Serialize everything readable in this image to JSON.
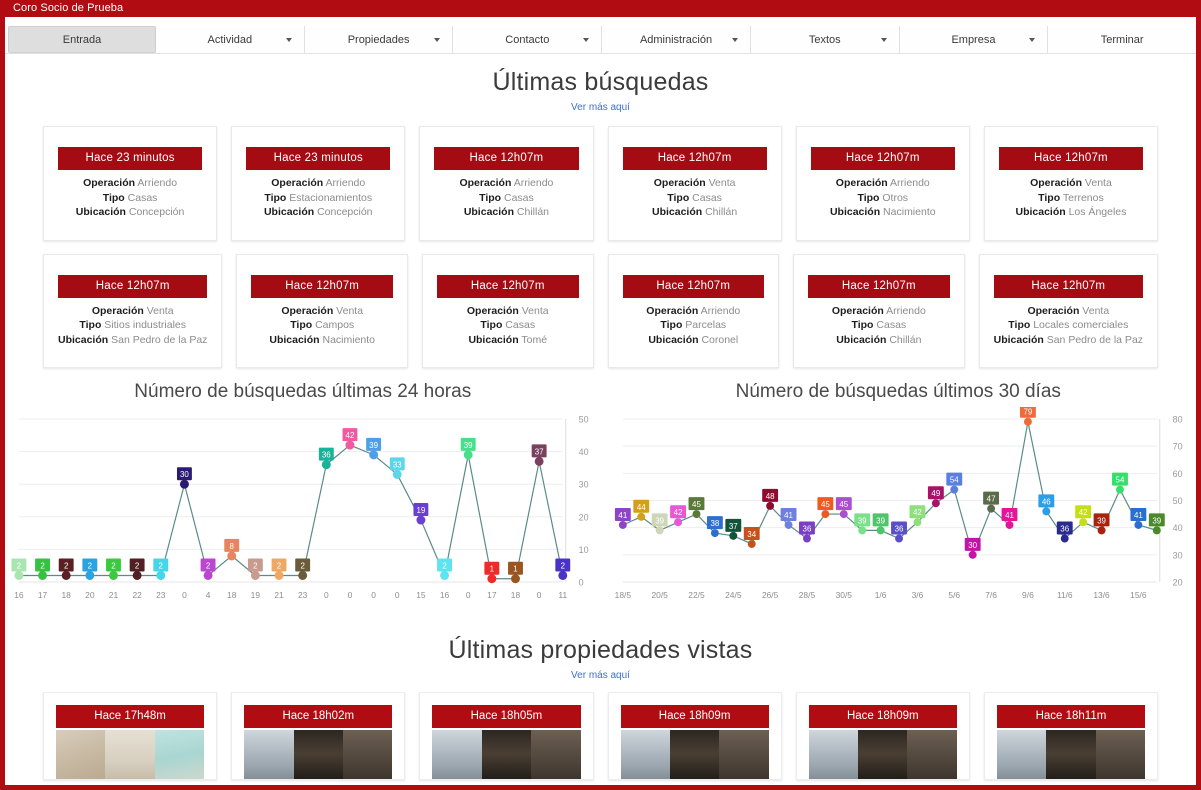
{
  "window": {
    "title": "Coro Socio de Prueba"
  },
  "nav": {
    "items": [
      {
        "label": "Entrada",
        "caret": false
      },
      {
        "label": "Actividad",
        "caret": true
      },
      {
        "label": "Propiedades",
        "caret": true
      },
      {
        "label": "Contacto",
        "caret": true
      },
      {
        "label": "Administración",
        "caret": true
      },
      {
        "label": "Textos",
        "caret": true
      },
      {
        "label": "Empresa",
        "caret": true
      },
      {
        "label": "Terminar",
        "caret": false
      }
    ]
  },
  "searches": {
    "title": "Últimas búsquedas",
    "link": "Ver más aquí",
    "labels": {
      "operacion": "Operación",
      "tipo": "Tipo",
      "ubicacion": "Ubicación"
    },
    "cards": [
      {
        "time": "Hace 23 minutos",
        "operacion": "Arriendo",
        "tipo": "Casas",
        "ubicacion": "Concepción"
      },
      {
        "time": "Hace 23 minutos",
        "operacion": "Arriendo",
        "tipo": "Estacionamientos",
        "ubicacion": "Concepción"
      },
      {
        "time": "Hace 12h07m",
        "operacion": "Arriendo",
        "tipo": "Casas",
        "ubicacion": "Chillán"
      },
      {
        "time": "Hace 12h07m",
        "operacion": "Venta",
        "tipo": "Casas",
        "ubicacion": "Chillán"
      },
      {
        "time": "Hace 12h07m",
        "operacion": "Arriendo",
        "tipo": "Otros",
        "ubicacion": "Nacimiento"
      },
      {
        "time": "Hace 12h07m",
        "operacion": "Venta",
        "tipo": "Terrenos",
        "ubicacion": "Los Ángeles"
      },
      {
        "time": "Hace 12h07m",
        "operacion": "Venta",
        "tipo": "Sitios industriales",
        "ubicacion": "San Pedro de la Paz"
      },
      {
        "time": "Hace 12h07m",
        "operacion": "Venta",
        "tipo": "Campos",
        "ubicacion": "Nacimiento"
      },
      {
        "time": "Hace 12h07m",
        "operacion": "Venta",
        "tipo": "Casas",
        "ubicacion": "Tomé"
      },
      {
        "time": "Hace 12h07m",
        "operacion": "Arriendo",
        "tipo": "Parcelas",
        "ubicacion": "Coronel"
      },
      {
        "time": "Hace 12h07m",
        "operacion": "Arriendo",
        "tipo": "Casas",
        "ubicacion": "Chillán"
      },
      {
        "time": "Hace 12h07m",
        "operacion": "Venta",
        "tipo": "Locales comerciales",
        "ubicacion": "San Pedro de la Paz"
      }
    ]
  },
  "properties": {
    "title": "Últimas propiedades vistas",
    "link": "Ver más aquí",
    "cards": [
      {
        "time": "Hace 17h48m",
        "photo": "art"
      },
      {
        "time": "Hace 18h02m",
        "photo": "sky"
      },
      {
        "time": "Hace 18h05m",
        "photo": "sky"
      },
      {
        "time": "Hace 18h09m",
        "photo": "sky"
      },
      {
        "time": "Hace 18h09m",
        "photo": "sky"
      },
      {
        "time": "Hace 18h11m",
        "photo": "sky"
      }
    ]
  },
  "chart_data": [
    {
      "type": "line",
      "title": "Número de búsquedas últimas 24 horas",
      "xlabel": "",
      "ylabel": "",
      "ylim": [
        0,
        50
      ],
      "yticks": [
        0,
        10,
        20,
        30,
        40,
        50
      ],
      "grid": true,
      "legend": false,
      "axis_position": "right",
      "categories": [
        "16",
        "17",
        "18",
        "20",
        "21",
        "22",
        "23",
        "0",
        "4",
        "18",
        "19",
        "21",
        "23",
        "0",
        "0",
        "0",
        "0",
        "15",
        "16",
        "0",
        "17",
        "18",
        "0",
        "11"
      ],
      "values": [
        2,
        2,
        2,
        2,
        2,
        2,
        2,
        30,
        2,
        8,
        2,
        2,
        2,
        36,
        42,
        39,
        33,
        19,
        2,
        39,
        1,
        1,
        37,
        2
      ],
      "point_colors": [
        "#a9e5b0",
        "#35c23f",
        "#5c1f22",
        "#2aa3e0",
        "#3bc93f",
        "#521f22",
        "#45d6e8",
        "#2b1b72",
        "#bb46d0",
        "#e8845e",
        "#c99a8e",
        "#efa863",
        "#6b5b3a",
        "#19b39a",
        "#ef5aa0",
        "#4f9fe8",
        "#5cd6e8",
        "#6c3fd4",
        "#5ce4f0",
        "#46e08a",
        "#ef2a2a",
        "#9a5520",
        "#7a4060",
        "#4a34c8"
      ],
      "label_colors": [
        "#a9e5b0",
        "#35c23f",
        "#5c1f22",
        "#2aa3e0",
        "#3bc93f",
        "#521f22",
        "#45d6e8",
        "#2b1b72",
        "#bb46d0",
        "#e8845e",
        "#c99a8e",
        "#efa863",
        "#6b5b3a",
        "#19b39a",
        "#ef5aa0",
        "#4f9fe8",
        "#5cd6e8",
        "#6c3fd4",
        "#5ce4f0",
        "#46e08a",
        "#ef2a2a",
        "#9a5520",
        "#7a4060",
        "#4a34c8"
      ]
    },
    {
      "type": "line",
      "title": "Número de búsquedas últimos 30 días",
      "xlabel": "",
      "ylabel": "",
      "ylim": [
        20,
        80
      ],
      "yticks": [
        20,
        30,
        40,
        50,
        60,
        70,
        80
      ],
      "grid": true,
      "legend": false,
      "axis_position": "right",
      "categories": [
        "18/5",
        "",
        "20/5",
        "",
        "22/5",
        "",
        "24/5",
        "",
        "26/5",
        "",
        "28/5",
        "",
        "30/5",
        "",
        "1/6",
        "",
        "3/6",
        "",
        "5/6",
        "",
        "7/6",
        "",
        "9/6",
        "",
        "11/6",
        "",
        "13/6",
        "",
        "15/6",
        ""
      ],
      "values": [
        41,
        44,
        39,
        42,
        45,
        38,
        37,
        34,
        48,
        41,
        36,
        45,
        45,
        39,
        39,
        36,
        42,
        49,
        54,
        30,
        47,
        41,
        79,
        46,
        36,
        42,
        39,
        54,
        41,
        39
      ],
      "point_colors": [
        "#8e44c4",
        "#d4a017",
        "#cfd6b8",
        "#e855d8",
        "#5a7a3a",
        "#2f6fd0",
        "#11543a",
        "#c4521a",
        "#8e0b30",
        "#6f7fe0",
        "#7a3fc4",
        "#ef5a22",
        "#a94fd0",
        "#7ae08a",
        "#4fc46a",
        "#5a4fc4",
        "#8ee07a",
        "#a8136a",
        "#5a7fe0",
        "#c413a8",
        "#5a6b4a",
        "#e8139a",
        "#ef6a3a",
        "#2a9fe8",
        "#2a2a8e",
        "#c4e013",
        "#a8220f",
        "#35e06a",
        "#2a6fd0",
        "#4a8a2a"
      ],
      "label_colors": [
        "#8e44c4",
        "#d4a017",
        "#cfd6b8",
        "#e855d8",
        "#5a7a3a",
        "#2f6fd0",
        "#11543a",
        "#c4521a",
        "#8e0b30",
        "#6f7fe0",
        "#7a3fc4",
        "#ef5a22",
        "#a94fd0",
        "#7ae08a",
        "#4fc46a",
        "#5a4fc4",
        "#8ee07a",
        "#a8136a",
        "#5a7fe0",
        "#c413a8",
        "#5a6b4a",
        "#e8139a",
        "#ef6a3a",
        "#2a9fe8",
        "#2a2a8e",
        "#c4e013",
        "#a8220f",
        "#35e06a",
        "#2a6fd0",
        "#4a8a2a"
      ]
    }
  ]
}
